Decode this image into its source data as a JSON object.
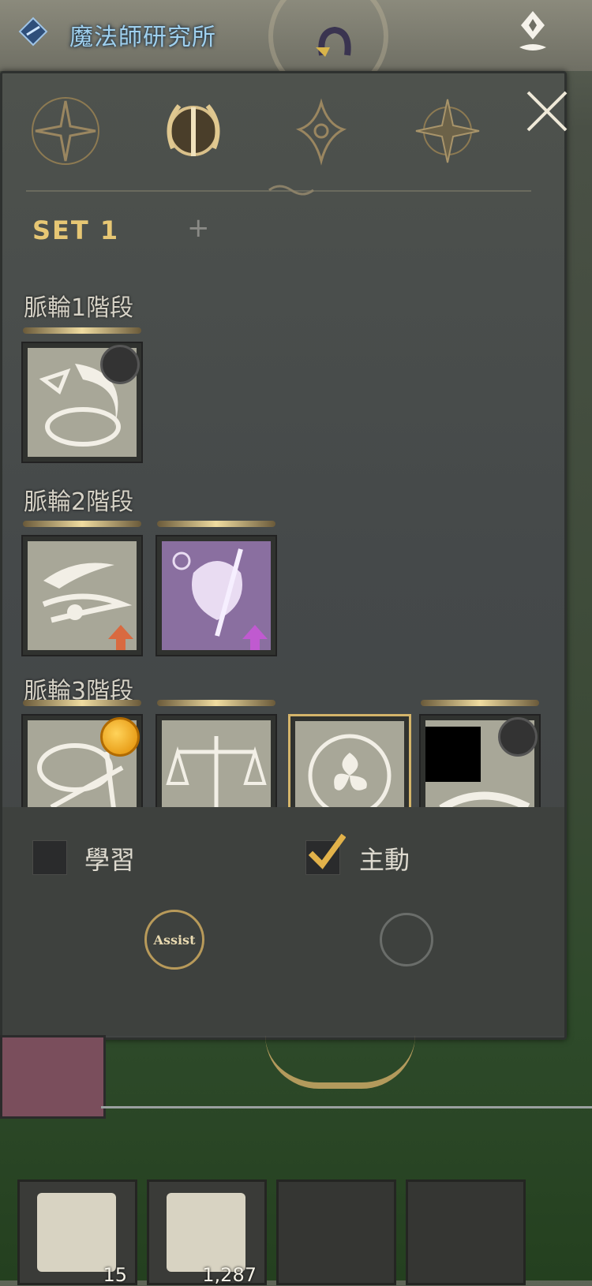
{
  "location": {
    "name": "魔法師研究所"
  },
  "panel": {
    "tabs": [
      {
        "name": "compass-star-tab"
      },
      {
        "name": "laurel-sword-tab"
      },
      {
        "name": "fleur-ornament-tab"
      },
      {
        "name": "compass-rose-tab"
      }
    ],
    "set_label": "SET 1",
    "add_set_label": "+",
    "tiers": [
      {
        "label": "脈輪1階段"
      },
      {
        "label": "脈輪2階段"
      },
      {
        "label": "脈輪3階段"
      }
    ],
    "learn_label": "學習",
    "active_label": "主動",
    "learn_checked": false,
    "active_checked": true,
    "assist_label": "Assist"
  },
  "quickslots": [
    {
      "count": "15"
    },
    {
      "count": "1,287"
    },
    {
      "count": ""
    },
    {
      "count": ""
    }
  ],
  "colors": {
    "gold": "#e7c774",
    "location_blue": "#9fd0ee",
    "panel": "#4a4e4b"
  }
}
